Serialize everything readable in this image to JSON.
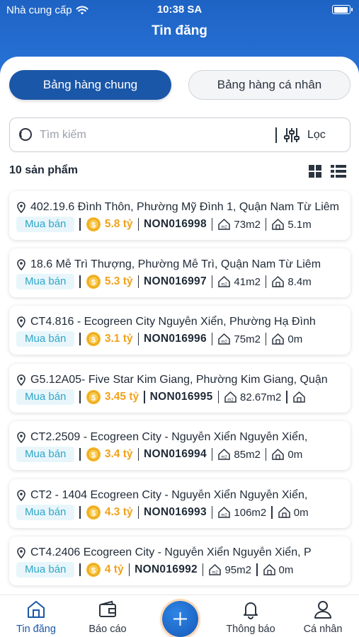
{
  "status": {
    "carrier": "Nhà cung cấp",
    "time": "10:38 SA"
  },
  "header": {
    "title": "Tin đăng"
  },
  "segments": {
    "common": "Bảng hàng chung",
    "personal": "Bảng hàng cá nhân"
  },
  "search": {
    "placeholder": "Tìm kiếm",
    "filter_label": "Lọc"
  },
  "list": {
    "count_label": "10 sản phẩm"
  },
  "listings": [
    {
      "address": "402.19.6  Đình Thôn, Phường Mỹ Đình 1, Quận Nam Từ Liêm",
      "type": "Mua bán",
      "price": "5.8 tỷ",
      "code": "NON016998",
      "area": "73m2",
      "frontage": "5.1m"
    },
    {
      "address": "18.6  Mễ Trì Thượng, Phường Mễ Trì, Quận Nam Từ Liêm",
      "type": "Mua bán",
      "price": "5.3 tỷ",
      "code": "NON016997",
      "area": "41m2",
      "frontage": "8.4m"
    },
    {
      "address": "CT4.816 - Ecogreen City  Nguyễn Xiển, Phường Hạ Đình",
      "type": "Mua bán",
      "price": "3.1 tỷ",
      "code": "NON016996",
      "area": "75m2",
      "frontage": "0m"
    },
    {
      "address": "G5.12A05- Five Star  Kim Giang, Phường Kim Giang, Quận",
      "type": "Mua bán",
      "price": "3.45 tỷ",
      "code": "NON016995",
      "area": "82.67m2",
      "frontage": ""
    },
    {
      "address": "CT2.2509 - Ecogreen City - Nguyễn Xiển  Nguyễn Xiển,",
      "type": "Mua bán",
      "price": "3.4 tỷ",
      "code": "NON016994",
      "area": "85m2",
      "frontage": "0m"
    },
    {
      "address": "CT2 - 1404 Ecogreen City - Nguyễn Xiển  Nguyễn Xiển,",
      "type": "Mua bán",
      "price": "4.3 tỷ",
      "code": "NON016993",
      "area": "106m2",
      "frontage": "0m"
    },
    {
      "address": "CT4.2406 Ecogreen City - Nguyễn Xiển  Nguyễn Xiển, P",
      "type": "Mua bán",
      "price": "4 tỷ",
      "code": "NON016992",
      "area": "95m2",
      "frontage": "0m"
    }
  ],
  "tabs": {
    "posts": "Tin đăng",
    "reports": "Báo cáo",
    "notifications": "Thông báo",
    "profile": "Cá nhân"
  },
  "colors": {
    "primary": "#1b57a8",
    "header_gradient_top": "#1e63c4",
    "price": "#f0a21c",
    "badge_text": "#2fa6c9",
    "badge_bg": "#e8f6fb"
  }
}
